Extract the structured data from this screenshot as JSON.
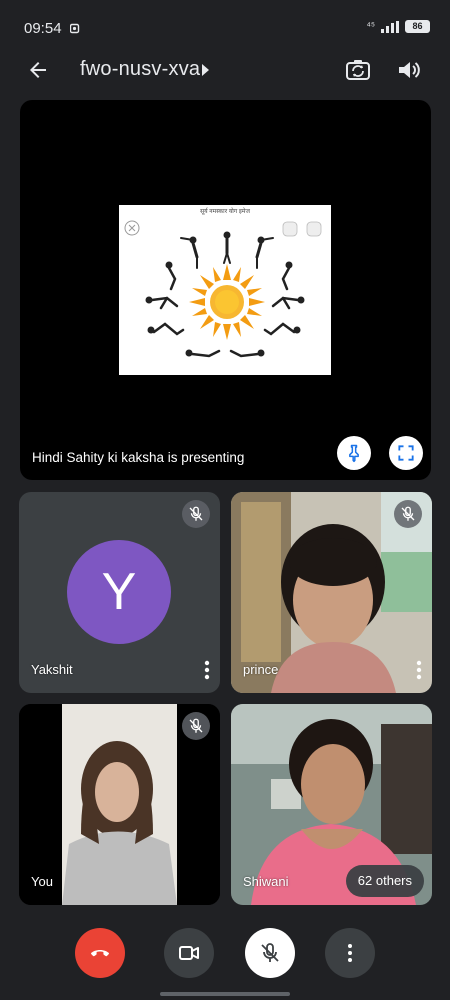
{
  "status_bar": {
    "time": "09:54",
    "signal_text": "⁴⁵",
    "battery": "86"
  },
  "top_bar": {
    "meeting_code": "fwo-nusv-xva",
    "icons": [
      "back-arrow-icon",
      "caret-right-icon",
      "switch-camera-icon",
      "speaker-icon"
    ]
  },
  "presentation": {
    "slide_title": "सूर्य नमस्कार योग इमेज",
    "presenter_label": "Hindi Sahity ki kaksha is presenting",
    "icons": [
      "pin-icon",
      "fullscreen-icon"
    ]
  },
  "participants": [
    {
      "name": "Yakshit",
      "avatar_letter": "Y",
      "avatar_color": "#7e57c2",
      "muted": true
    },
    {
      "name": "prince",
      "muted": true
    },
    {
      "name": "You",
      "muted": true
    },
    {
      "name": "Shiwani",
      "others": "62 others"
    }
  ],
  "controls": {
    "icons": [
      "end-call-icon",
      "camera-icon",
      "mic-off-icon",
      "more-vert-icon"
    ],
    "hangup_color": "#ea4335"
  },
  "colors": {
    "background": "#202124",
    "tile": "#3c4043",
    "accent_blue": "#1a73e8"
  }
}
